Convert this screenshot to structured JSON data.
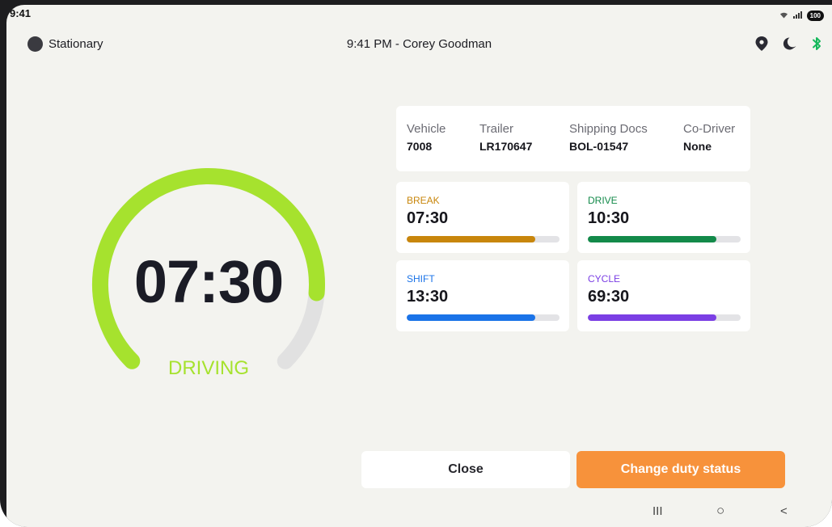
{
  "system": {
    "time": "9:41",
    "battery": "100"
  },
  "header": {
    "status_label": "Stationary",
    "title": "9:41 PM - Corey Goodman"
  },
  "gauge": {
    "time": "07:30",
    "status": "DRIVING",
    "progress": 0.85,
    "color": "#a6e22e",
    "track_color": "#e1e1e1"
  },
  "info": {
    "vehicle": {
      "label": "Vehicle",
      "value": "7008"
    },
    "trailer": {
      "label": "Trailer",
      "value": "LR170647"
    },
    "shipping": {
      "label": "Shipping Docs",
      "value": "BOL-01547"
    },
    "codriver": {
      "label": "Co-Driver",
      "value": "None"
    }
  },
  "stats": {
    "break": {
      "label": "BREAK",
      "value": "07:30",
      "progress": 0.84,
      "color": "#c8860c"
    },
    "drive": {
      "label": "DRIVE",
      "value": "10:30",
      "progress": 0.84,
      "color": "#138a4a"
    },
    "shift": {
      "label": "SHIFT",
      "value": "13:30",
      "progress": 0.84,
      "color": "#1a73e8"
    },
    "cycle": {
      "label": "CYCLE",
      "value": "69:30",
      "progress": 0.84,
      "color": "#7b3fe4"
    }
  },
  "actions": {
    "close_label": "Close",
    "change_label": "Change duty status"
  },
  "icons": [
    "wifi-icon",
    "signal-icon",
    "battery-icon",
    "location-pin-icon",
    "moon-icon",
    "bluetooth-icon",
    "recent-apps-icon",
    "home-icon",
    "back-icon"
  ],
  "nav": {
    "recent": "III",
    "home": "○",
    "back": "<"
  }
}
